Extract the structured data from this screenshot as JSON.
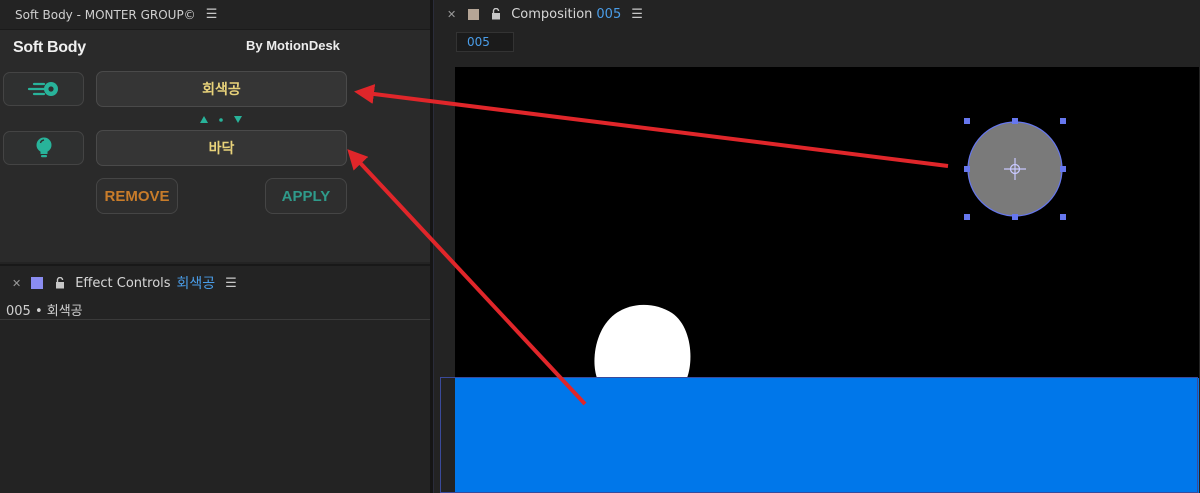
{
  "soft_body_panel": {
    "tab_title": "Soft Body - MONTER GROUP©",
    "menu_icon": "hamburger-menu-icon",
    "title": "Soft Body",
    "credit": "By MotionDesk",
    "ball_layer_label": "회색공",
    "floor_layer_label": "바닥",
    "ball_icon": "speeding-ball-icon",
    "floor_icon": "lightbulb-icon",
    "swap_icon": "swap-arrows-icon",
    "remove_label": "REMOVE",
    "apply_label": "APPLY",
    "colors": {
      "layer_text": "#e8d27a",
      "remove": "#c87c2a",
      "apply": "#2f9a8a",
      "icon": "#28b39a"
    }
  },
  "effect_controls": {
    "close_icon": "close-icon",
    "swatch_color": "#8a8cf0",
    "lock_icon": "unlock-icon",
    "title": "Effect Controls",
    "layer_name": "회색공",
    "path": "005 • 회색공"
  },
  "composition": {
    "close_icon": "close-icon",
    "swatch_color": "#b5a596",
    "lock_icon": "unlock-icon",
    "title": "Composition",
    "number": "005",
    "subtab": "005",
    "colors": {
      "background": "#000000",
      "floor": "#0077ea",
      "gray_ball": "#7a7a7a",
      "white_ball": "#ffffff",
      "selection": "#6677ee"
    }
  },
  "annotation": {
    "arrow_color": "#e0262a"
  }
}
